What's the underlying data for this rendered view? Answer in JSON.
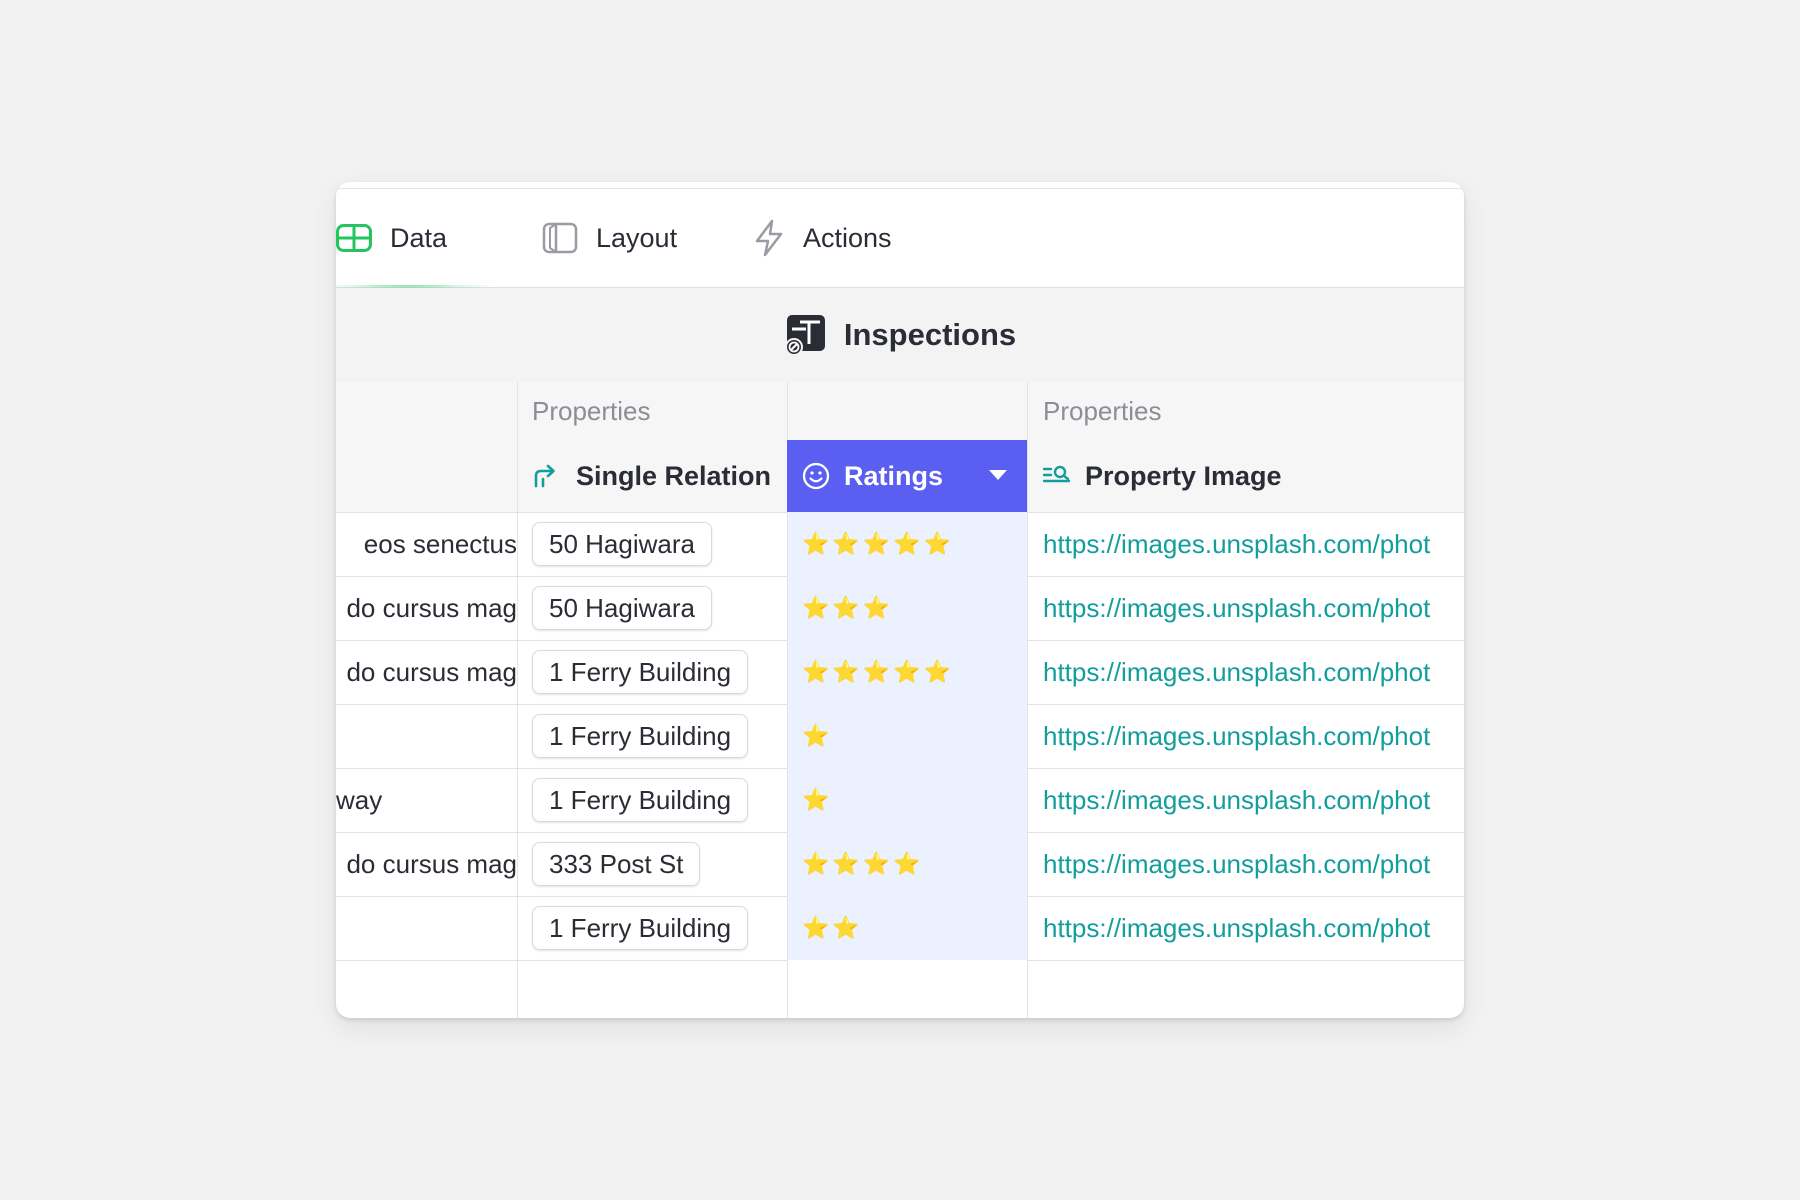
{
  "tabs": [
    {
      "label": "Data",
      "icon": "table-icon",
      "active": true
    },
    {
      "label": "Layout",
      "icon": "layout-icon",
      "active": false
    },
    {
      "label": "Actions",
      "icon": "lightning-icon",
      "active": false
    }
  ],
  "table_title": "Inspections",
  "groups": {
    "col1": "Properties",
    "col3": "Properties"
  },
  "columns": [
    {
      "label": "Single Relation",
      "icon": "relation-arrow-icon"
    },
    {
      "label": "Ratings",
      "icon": "smiley-icon",
      "selected": true
    },
    {
      "label": "Property Image",
      "icon": "image-search-icon"
    }
  ],
  "rows": [
    {
      "text": "eos senectus",
      "relation": "50 Hagiwara",
      "stars": "⭐⭐⭐⭐⭐",
      "rating": 5,
      "link": "https://images.unsplash.com/phot"
    },
    {
      "text": "do cursus mag",
      "relation": "50 Hagiwara",
      "stars": "⭐⭐⭐",
      "rating": 3,
      "link": "https://images.unsplash.com/phot"
    },
    {
      "text": "do cursus mag",
      "relation": "1 Ferry Building",
      "stars": "⭐⭐⭐⭐⭐",
      "rating": 5,
      "link": "https://images.unsplash.com/phot"
    },
    {
      "text": "",
      "relation": "1 Ferry Building",
      "stars": "⭐",
      "rating": 1,
      "link": "https://images.unsplash.com/phot"
    },
    {
      "text": "way",
      "relation": "1 Ferry Building",
      "stars": "⭐",
      "rating": 1,
      "link": "https://images.unsplash.com/phot"
    },
    {
      "text": "do cursus mag",
      "relation": "333 Post St",
      "stars": "⭐⭐⭐⭐",
      "rating": 4,
      "link": "https://images.unsplash.com/phot"
    },
    {
      "text": "",
      "relation": "1 Ferry Building",
      "stars": "⭐⭐",
      "rating": 2,
      "link": "https://images.unsplash.com/phot"
    }
  ],
  "colors": {
    "accent_selected": "#5a5ff2",
    "link": "#129e9c",
    "data_tab": "#22c55e",
    "ratings_bg": "#ebf1fe"
  }
}
